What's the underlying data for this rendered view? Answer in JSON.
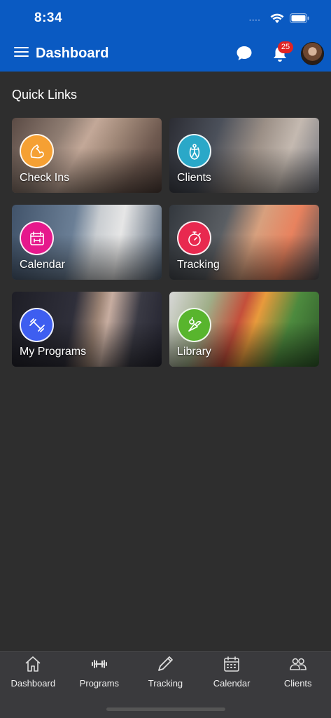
{
  "status_bar": {
    "time": "8:34"
  },
  "header": {
    "title": "Dashboard",
    "notification_count": "25"
  },
  "quick_links": {
    "title": "Quick Links",
    "tiles": [
      {
        "label": "Check Ins",
        "icon": "flexed-arm-icon",
        "icon_color": "#f5a033"
      },
      {
        "label": "Clients",
        "icon": "jump-rope-icon",
        "icon_color": "#2aa8c8"
      },
      {
        "label": "Calendar",
        "icon": "calendar-icon",
        "icon_color": "#e6188c"
      },
      {
        "label": "Tracking",
        "icon": "stopwatch-icon",
        "icon_color": "#e8294f"
      },
      {
        "label": "My Programs",
        "icon": "dumbbell-icon",
        "icon_color": "#3e5ef0"
      },
      {
        "label": "Library",
        "icon": "vegetables-icon",
        "icon_color": "#58b52d"
      }
    ]
  },
  "tabbar": {
    "items": [
      {
        "label": "Dashboard",
        "icon": "home-icon"
      },
      {
        "label": "Programs",
        "icon": "dumbbell-icon"
      },
      {
        "label": "Tracking",
        "icon": "pencil-icon"
      },
      {
        "label": "Calendar",
        "icon": "calendar-icon"
      },
      {
        "label": "Clients",
        "icon": "people-icon"
      }
    ]
  },
  "colors": {
    "header_bg": "#0a5ac2",
    "page_bg": "#2e2e2e",
    "tabbar_bg": "#3a3a3d",
    "badge": "#e02424"
  }
}
